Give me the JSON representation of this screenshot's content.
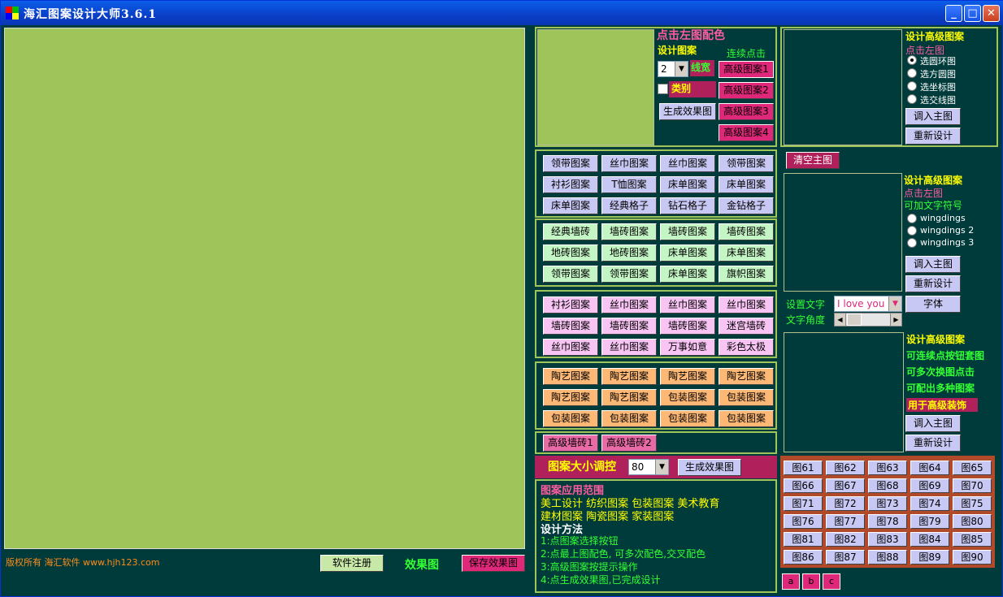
{
  "titlebar": {
    "title": "海汇图案设计大师3.6.1",
    "minimize_icon": "minimize-icon",
    "maximize_icon": "maximize-icon",
    "close_icon": "close-icon"
  },
  "footer": {
    "copyright": "版权所有 海汇软件 www.hjh123.com",
    "register_button": "软件注册",
    "effect_label": "效果图",
    "save_button": "保存效果图"
  },
  "top_design": {
    "click_hint": "点击左图配色",
    "design_label": "设计图案",
    "continuous_label": "连续点击",
    "line_width_value": "2",
    "line_width_label": "线宽",
    "category_label": "类别",
    "generate_button": "生成效果图",
    "advanced_buttons": [
      "高级图案1",
      "高级图案2",
      "高级图案3",
      "高级图案4"
    ]
  },
  "group1": [
    "领带图案",
    "丝巾图案",
    "丝巾图案",
    "领带图案",
    "衬衫图案",
    "T恤图案",
    "床单图案",
    "床单图案",
    "床单图案",
    "经典格子",
    "钻石格子",
    "金钻格子"
  ],
  "group2": [
    "经典墙砖",
    "墙砖图案",
    "墙砖图案",
    "墙砖图案",
    "地砖图案",
    "地砖图案",
    "床单图案",
    "床单图案",
    "领带图案",
    "领带图案",
    "床单图案",
    "旗帜图案"
  ],
  "group3": [
    "衬衫图案",
    "丝巾图案",
    "丝巾图案",
    "丝巾图案",
    "墙砖图案",
    "墙砖图案",
    "墙砖图案",
    "迷宫墙砖",
    "丝巾图案",
    "丝巾图案",
    "万事如意",
    "彩色太极"
  ],
  "group4": [
    "陶艺图案",
    "陶艺图案",
    "陶艺图案",
    "陶艺图案",
    "陶艺图案",
    "陶艺图案",
    "包装图案",
    "包装图案",
    "包装图案",
    "包装图案",
    "包装图案",
    "包装图案"
  ],
  "advanced_tiles": [
    "高级墙砖1",
    "高级墙砖2"
  ],
  "size_control": {
    "label": "图案大小调控",
    "value": "80",
    "generate_button": "生成效果图"
  },
  "info": {
    "scope_title": "图案应用范围",
    "scope_line1": "美工设计  纺织图案  包装图案  美术教育",
    "scope_line2": "建材图案  陶瓷图案  家装图案",
    "method_title": "设计方法",
    "steps": [
      "1:点图案选择按钮",
      "2:点最上图配色, 可多次配色,交叉配色",
      "3:高级图案按提示操作",
      "4:点生成效果图,已完成设计"
    ]
  },
  "adv1": {
    "title": "设计高级图案",
    "hint": "点击左图",
    "options": [
      "选圆环图",
      "选方圆图",
      "选坐标图",
      "选交线图"
    ],
    "selected": 0,
    "import_button": "调入主图",
    "redesign_button": "重新设计",
    "clear_button": "清空主图"
  },
  "adv2": {
    "title": "设计高级图案",
    "hint": "点击左图",
    "hint2": "可加文字符号",
    "options": [
      "wingdings",
      "wingdings 2",
      "wingdings 3"
    ],
    "import_button": "调入主图",
    "redesign_button": "重新设计",
    "set_text_label": "设置文字",
    "text_value": "I love you",
    "angle_label": "文字角度",
    "font_button": "字体"
  },
  "adv3": {
    "title": "设计高级图案",
    "line1": "可连续点按钮套图",
    "line2": "可多次换图点击",
    "line3": "可配出多种图案",
    "line4": "用于高级装饰",
    "import_button": "调入主图",
    "redesign_button": "重新设计"
  },
  "image_grid": [
    "图61",
    "图62",
    "图63",
    "图64",
    "图65",
    "图66",
    "图67",
    "图68",
    "图69",
    "图70",
    "图71",
    "图72",
    "图73",
    "图74",
    "图75",
    "图76",
    "图77",
    "图78",
    "图79",
    "图80",
    "图81",
    "图82",
    "图83",
    "图84",
    "图85",
    "图86",
    "图87",
    "图88",
    "图89",
    "图90"
  ],
  "letter_buttons": [
    "a",
    "b",
    "c"
  ]
}
